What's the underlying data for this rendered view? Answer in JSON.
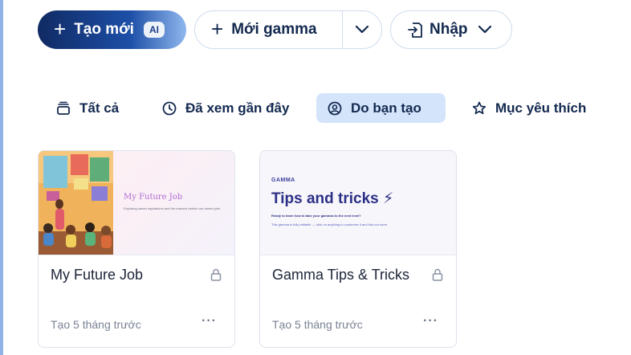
{
  "toolbar": {
    "create_label": "Tạo mới",
    "ai_badge": "AI",
    "new_gamma_label": "Mới gamma",
    "import_label": "Nhập"
  },
  "tabs": [
    {
      "label": "Tất cả",
      "icon": "stack-icon"
    },
    {
      "label": "Đã xem gần đây",
      "icon": "clock-icon"
    },
    {
      "label": "Do bạn tạo",
      "icon": "user-icon",
      "active": true
    },
    {
      "label": "Mục yêu thích",
      "icon": "star-icon"
    }
  ],
  "cards": [
    {
      "title": "My Future Job",
      "meta": "Tạo 5 tháng trước",
      "thumb_title": "My Future Job",
      "thumb_subtitle": "Exploring career aspirations and the reasons behind our dream jobs"
    },
    {
      "title": "Gamma Tips & Tricks",
      "meta": "Tạo 5 tháng trước",
      "thumb_logo": "GAMMA",
      "thumb_title": "Tips and tricks ⚡",
      "thumb_line1": "Ready to learn how to take your gammas to the next level?",
      "thumb_line2": "This gamma is fully editable — click on anything to customize it and find out more."
    }
  ],
  "more_label": "···",
  "colors": {
    "accent": "#1d4fa7",
    "active_tab_bg": "#d4e4fb"
  }
}
